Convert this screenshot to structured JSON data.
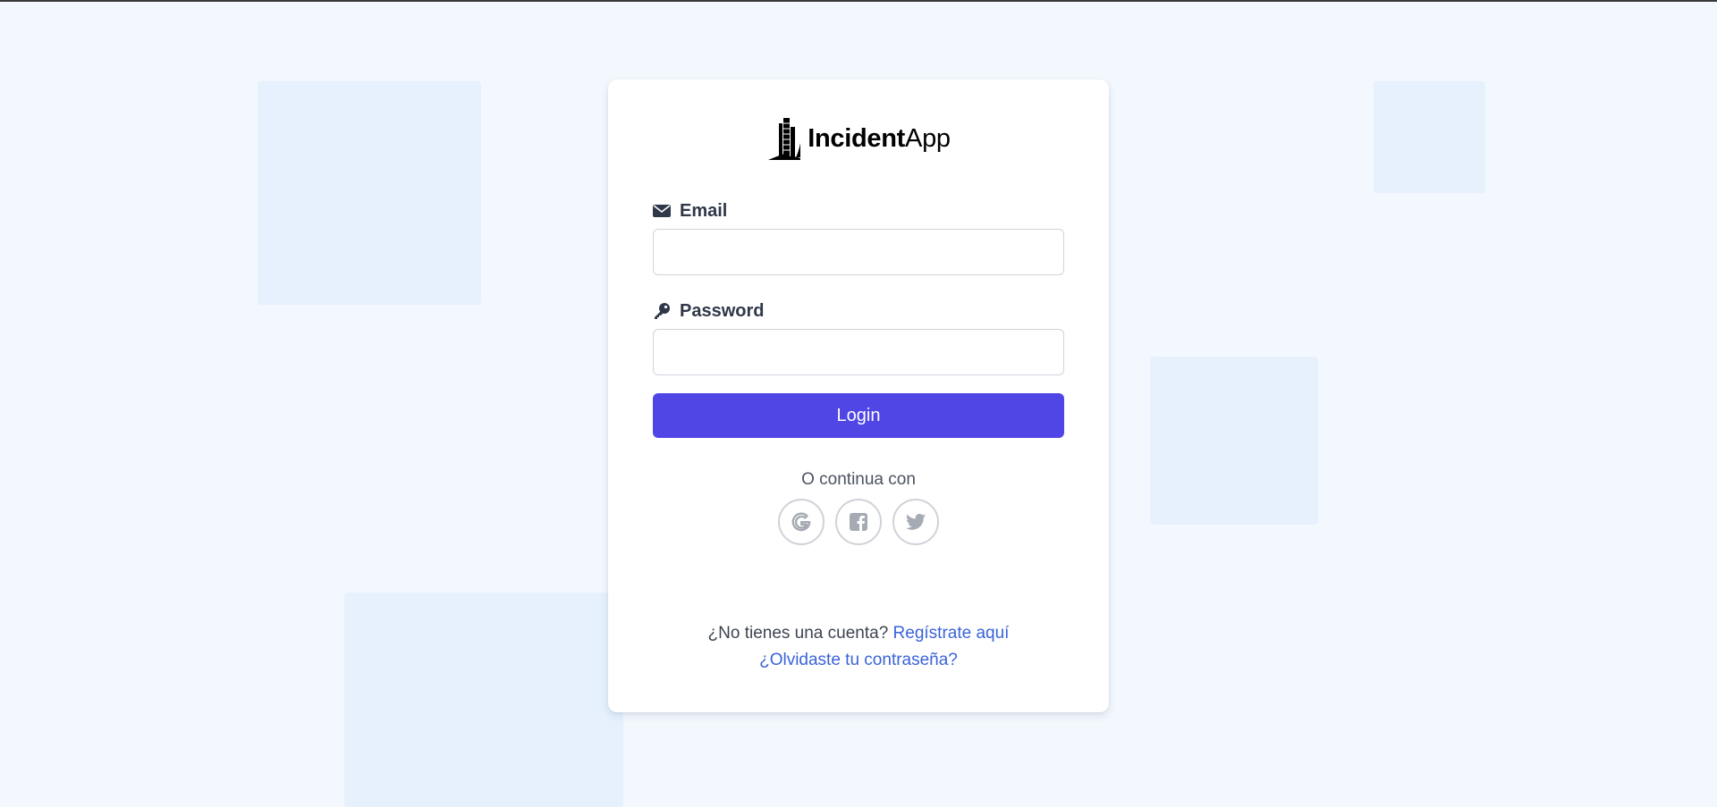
{
  "brand": {
    "name_bold": "Incident",
    "name_regular": "App",
    "logo_icon": "building-logo-icon"
  },
  "form": {
    "email_label": "Email",
    "email_icon": "envelope-icon",
    "email_value": "",
    "password_label": "Password",
    "password_icon": "key-icon",
    "password_value": "",
    "login_label": "Login"
  },
  "social": {
    "or_text": "O continua con",
    "providers": [
      "google-icon",
      "facebook-icon",
      "twitter-icon"
    ]
  },
  "footer": {
    "no_account_text": "¿No tienes una cuenta?",
    "register_link": "Regístrate aquí",
    "forgot_link": "¿Olvidaste tu contraseña?"
  },
  "colors": {
    "background": "#f2f8fd",
    "decor": "#e6f1fd",
    "primary": "#4f46e5",
    "link": "#3a63d8"
  }
}
